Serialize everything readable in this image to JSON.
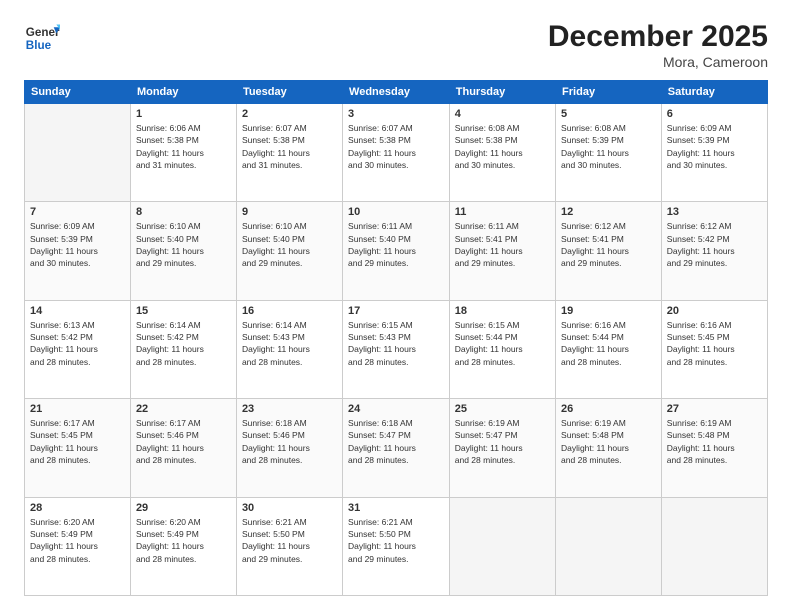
{
  "header": {
    "logo_line1": "General",
    "logo_line2": "Blue",
    "month": "December 2025",
    "location": "Mora, Cameroon"
  },
  "days_of_week": [
    "Sunday",
    "Monday",
    "Tuesday",
    "Wednesday",
    "Thursday",
    "Friday",
    "Saturday"
  ],
  "weeks": [
    [
      {
        "num": "",
        "info": ""
      },
      {
        "num": "1",
        "info": "Sunrise: 6:06 AM\nSunset: 5:38 PM\nDaylight: 11 hours\nand 31 minutes."
      },
      {
        "num": "2",
        "info": "Sunrise: 6:07 AM\nSunset: 5:38 PM\nDaylight: 11 hours\nand 31 minutes."
      },
      {
        "num": "3",
        "info": "Sunrise: 6:07 AM\nSunset: 5:38 PM\nDaylight: 11 hours\nand 30 minutes."
      },
      {
        "num": "4",
        "info": "Sunrise: 6:08 AM\nSunset: 5:38 PM\nDaylight: 11 hours\nand 30 minutes."
      },
      {
        "num": "5",
        "info": "Sunrise: 6:08 AM\nSunset: 5:39 PM\nDaylight: 11 hours\nand 30 minutes."
      },
      {
        "num": "6",
        "info": "Sunrise: 6:09 AM\nSunset: 5:39 PM\nDaylight: 11 hours\nand 30 minutes."
      }
    ],
    [
      {
        "num": "7",
        "info": "Sunrise: 6:09 AM\nSunset: 5:39 PM\nDaylight: 11 hours\nand 30 minutes."
      },
      {
        "num": "8",
        "info": "Sunrise: 6:10 AM\nSunset: 5:40 PM\nDaylight: 11 hours\nand 29 minutes."
      },
      {
        "num": "9",
        "info": "Sunrise: 6:10 AM\nSunset: 5:40 PM\nDaylight: 11 hours\nand 29 minutes."
      },
      {
        "num": "10",
        "info": "Sunrise: 6:11 AM\nSunset: 5:40 PM\nDaylight: 11 hours\nand 29 minutes."
      },
      {
        "num": "11",
        "info": "Sunrise: 6:11 AM\nSunset: 5:41 PM\nDaylight: 11 hours\nand 29 minutes."
      },
      {
        "num": "12",
        "info": "Sunrise: 6:12 AM\nSunset: 5:41 PM\nDaylight: 11 hours\nand 29 minutes."
      },
      {
        "num": "13",
        "info": "Sunrise: 6:12 AM\nSunset: 5:42 PM\nDaylight: 11 hours\nand 29 minutes."
      }
    ],
    [
      {
        "num": "14",
        "info": "Sunrise: 6:13 AM\nSunset: 5:42 PM\nDaylight: 11 hours\nand 28 minutes."
      },
      {
        "num": "15",
        "info": "Sunrise: 6:14 AM\nSunset: 5:42 PM\nDaylight: 11 hours\nand 28 minutes."
      },
      {
        "num": "16",
        "info": "Sunrise: 6:14 AM\nSunset: 5:43 PM\nDaylight: 11 hours\nand 28 minutes."
      },
      {
        "num": "17",
        "info": "Sunrise: 6:15 AM\nSunset: 5:43 PM\nDaylight: 11 hours\nand 28 minutes."
      },
      {
        "num": "18",
        "info": "Sunrise: 6:15 AM\nSunset: 5:44 PM\nDaylight: 11 hours\nand 28 minutes."
      },
      {
        "num": "19",
        "info": "Sunrise: 6:16 AM\nSunset: 5:44 PM\nDaylight: 11 hours\nand 28 minutes."
      },
      {
        "num": "20",
        "info": "Sunrise: 6:16 AM\nSunset: 5:45 PM\nDaylight: 11 hours\nand 28 minutes."
      }
    ],
    [
      {
        "num": "21",
        "info": "Sunrise: 6:17 AM\nSunset: 5:45 PM\nDaylight: 11 hours\nand 28 minutes."
      },
      {
        "num": "22",
        "info": "Sunrise: 6:17 AM\nSunset: 5:46 PM\nDaylight: 11 hours\nand 28 minutes."
      },
      {
        "num": "23",
        "info": "Sunrise: 6:18 AM\nSunset: 5:46 PM\nDaylight: 11 hours\nand 28 minutes."
      },
      {
        "num": "24",
        "info": "Sunrise: 6:18 AM\nSunset: 5:47 PM\nDaylight: 11 hours\nand 28 minutes."
      },
      {
        "num": "25",
        "info": "Sunrise: 6:19 AM\nSunset: 5:47 PM\nDaylight: 11 hours\nand 28 minutes."
      },
      {
        "num": "26",
        "info": "Sunrise: 6:19 AM\nSunset: 5:48 PM\nDaylight: 11 hours\nand 28 minutes."
      },
      {
        "num": "27",
        "info": "Sunrise: 6:19 AM\nSunset: 5:48 PM\nDaylight: 11 hours\nand 28 minutes."
      }
    ],
    [
      {
        "num": "28",
        "info": "Sunrise: 6:20 AM\nSunset: 5:49 PM\nDaylight: 11 hours\nand 28 minutes."
      },
      {
        "num": "29",
        "info": "Sunrise: 6:20 AM\nSunset: 5:49 PM\nDaylight: 11 hours\nand 28 minutes."
      },
      {
        "num": "30",
        "info": "Sunrise: 6:21 AM\nSunset: 5:50 PM\nDaylight: 11 hours\nand 29 minutes."
      },
      {
        "num": "31",
        "info": "Sunrise: 6:21 AM\nSunset: 5:50 PM\nDaylight: 11 hours\nand 29 minutes."
      },
      {
        "num": "",
        "info": ""
      },
      {
        "num": "",
        "info": ""
      },
      {
        "num": "",
        "info": ""
      }
    ]
  ]
}
